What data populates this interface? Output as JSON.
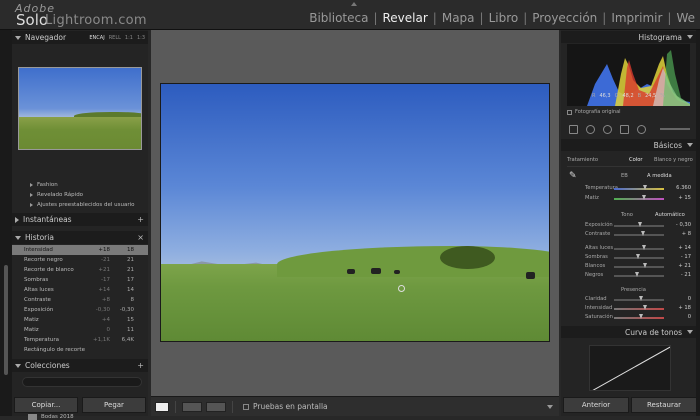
{
  "app": {
    "logo_top": "Adobe",
    "logo_brand": "Solo",
    "logo_name": "Lightroom.com",
    "modules": [
      "Biblioteca",
      "Revelar",
      "Mapa",
      "Libro",
      "Proyección",
      "Imprimir",
      "We"
    ],
    "active_module": "Revelar"
  },
  "left": {
    "navigator": {
      "title": "Navegador",
      "modes": [
        "ENCAJ",
        "RELL",
        "1:1",
        "1:3"
      ]
    },
    "presets": [
      "Fashion",
      "Revelado Rápido",
      "Ajustes preestablecidos del usuario"
    ],
    "snapshots": {
      "title": "Instantáneas",
      "action": "+"
    },
    "history": {
      "title": "Historia",
      "action": "×",
      "rows": [
        {
          "name": "Intensidad",
          "a": "+18",
          "b": "18"
        },
        {
          "name": "Recorte negro",
          "a": "-21",
          "b": "21"
        },
        {
          "name": "Recorte de blanco",
          "a": "+21",
          "b": "21"
        },
        {
          "name": "Sombras",
          "a": "-17",
          "b": "17"
        },
        {
          "name": "Altas luces",
          "a": "+14",
          "b": "14"
        },
        {
          "name": "Contraste",
          "a": "+8",
          "b": "8"
        },
        {
          "name": "Exposición",
          "a": "-0,30",
          "b": "-0,30"
        },
        {
          "name": "Matiz",
          "a": "+4",
          "b": "15"
        },
        {
          "name": "Matiz",
          "a": "0",
          "b": "11"
        },
        {
          "name": "Temperatura",
          "a": "+1,1K",
          "b": "6,4K"
        },
        {
          "name": "Rectángulo de recorte",
          "a": "",
          "b": ""
        }
      ]
    },
    "collections": {
      "title": "Colecciones",
      "action": "+",
      "item": "Bodas 2018"
    },
    "copy_button": "Copiar...",
    "paste_button": "Pegar"
  },
  "toolbar": {
    "proof_label": "Pruebas en pantalla"
  },
  "right": {
    "histogram": {
      "title": "Histograma",
      "r_label": "R",
      "r": "46,3",
      "g_label": "G",
      "g": "48,2",
      "b_label": "B",
      "b": "24,5",
      "pct": "%",
      "original_photo": "Fotografía original"
    },
    "basic": {
      "title": "Básicos",
      "treatment_label": "Tratamiento",
      "treatment_color": "Color",
      "treatment_bw": "Blanco y negro",
      "wb_label": "EB",
      "wb_value": "A medida",
      "temp_label": "Temperatura",
      "temp_value": "6.360",
      "tint_label": "Matiz",
      "tint_value": "+ 15",
      "tone_label": "Tono",
      "auto_label": "Automático",
      "exposure_label": "Exposición",
      "exposure_value": "- 0,30",
      "contrast_label": "Contraste",
      "contrast_value": "+ 8",
      "highlights_label": "Altas luces",
      "highlights_value": "+ 14",
      "shadows_label": "Sombras",
      "shadows_value": "- 17",
      "whites_label": "Blancos",
      "whites_value": "+ 21",
      "blacks_label": "Negros",
      "blacks_value": "- 21",
      "presence_label": "Presencia",
      "clarity_label": "Claridad",
      "clarity_value": "0",
      "vibrance_label": "Intensidad",
      "vibrance_value": "+ 18",
      "saturation_label": "Saturación",
      "saturation_value": "0"
    },
    "tone_curve": {
      "title": "Curva de tonos"
    },
    "previous_button": "Anterior",
    "reset_button": "Restaurar"
  },
  "colors": {
    "accent": "#eeeeee",
    "panel": "#242424",
    "canvas": "#5a5a5a"
  }
}
